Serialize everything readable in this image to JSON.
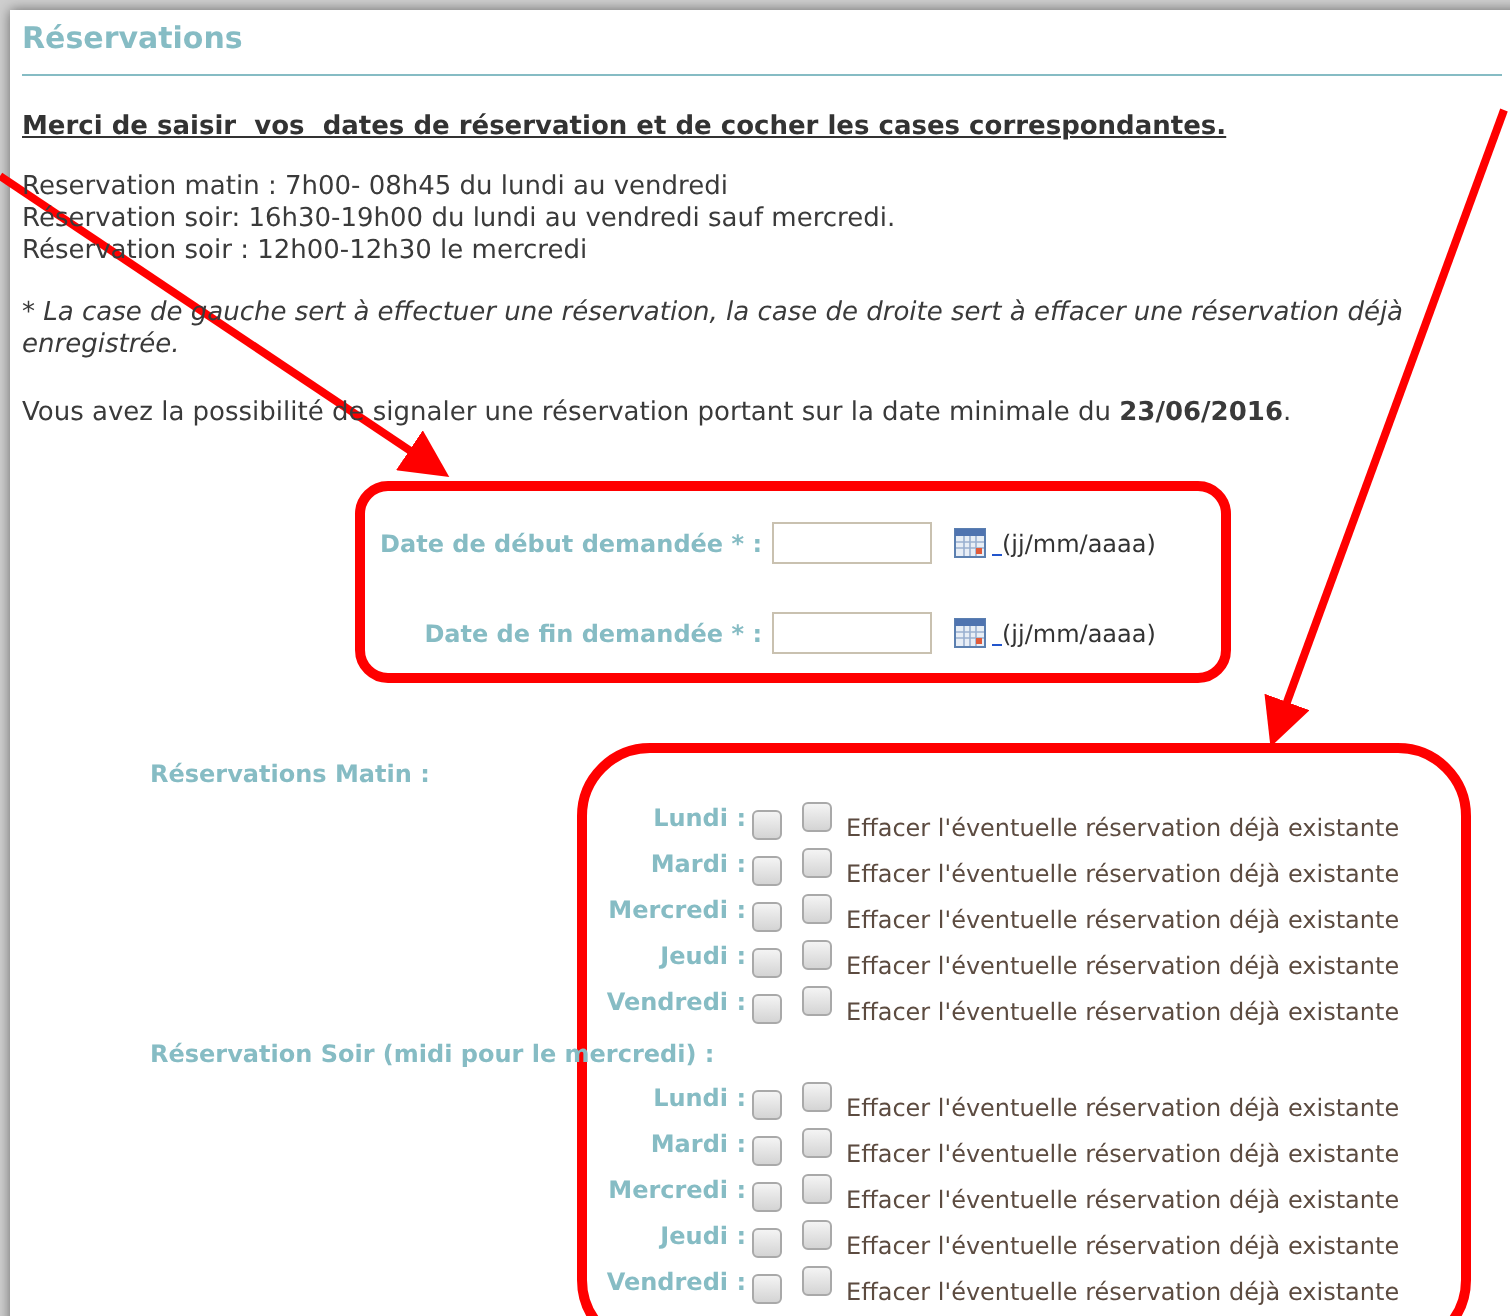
{
  "section_title": "Réservations",
  "instructions": "Merci de saisir  vos  dates de réservation et de cocher les cases correspondantes.",
  "schedule_lines": [
    "Reservation matin : 7h00- 08h45 du lundi au vendredi",
    "Réservation soir: 16h30-19h00 du lundi au vendredi sauf mercredi.",
    "Réservation soir : 12h00-12h30 le mercredi"
  ],
  "note_lines": [
    "* La case de gauche sert à effectuer une réservation, la case de droite sert à effacer une réservation déjà",
    "enregistrée."
  ],
  "minimum_date_text": "Vous avez la possibilité de signaler une réservation portant sur la date minimale du **23/06/2016**.",
  "date_fields": [
    {
      "label": "Date de début demandée * :",
      "format_hint": "(jj/mm/aaaa)"
    },
    {
      "label": "Date de fin demandée * :",
      "format_hint": "(jj/mm/aaaa)"
    }
  ],
  "groups": [
    {
      "title": "Réservations Matin :",
      "days": [
        {
          "label": "Lundi :",
          "reserve_checked": false,
          "clear_checked": false,
          "clear_label": "Effacer l'éventuelle réservation déjà existante"
        },
        {
          "label": "Mardi :",
          "reserve_checked": false,
          "clear_checked": false,
          "clear_label": "Effacer l'éventuelle réservation déjà existante"
        },
        {
          "label": "Mercredi :",
          "reserve_checked": false,
          "clear_checked": false,
          "clear_label": "Effacer l'éventuelle réservation déjà existante"
        },
        {
          "label": "Jeudi :",
          "reserve_checked": false,
          "clear_checked": false,
          "clear_label": "Effacer l'éventuelle réservation déjà existante"
        },
        {
          "label": "Vendredi :",
          "reserve_checked": false,
          "clear_checked": false,
          "clear_label": "Effacer l'éventuelle réservation déjà existante"
        }
      ]
    },
    {
      "title": "Réservation Soir (midi pour le mercredi) :",
      "days": [
        {
          "label": "Lundi :",
          "reserve_checked": false,
          "clear_checked": false,
          "clear_label": "Effacer l'éventuelle réservation déjà existante"
        },
        {
          "label": "Mardi :",
          "reserve_checked": false,
          "clear_checked": false,
          "clear_label": "Effacer l'éventuelle réservation déjà existante"
        },
        {
          "label": "Mercredi :",
          "reserve_checked": false,
          "clear_checked": false,
          "clear_label": "Effacer l'éventuelle réservation déjà existante"
        },
        {
          "label": "Jeudi :",
          "reserve_checked": false,
          "clear_checked": false,
          "clear_label": "Effacer l'éventuelle réservation déjà existante"
        },
        {
          "label": "Vendredi :",
          "reserve_checked": false,
          "clear_checked": false,
          "clear_label": "Effacer l'éventuelle réservation déjà existante"
        }
      ]
    }
  ]
}
